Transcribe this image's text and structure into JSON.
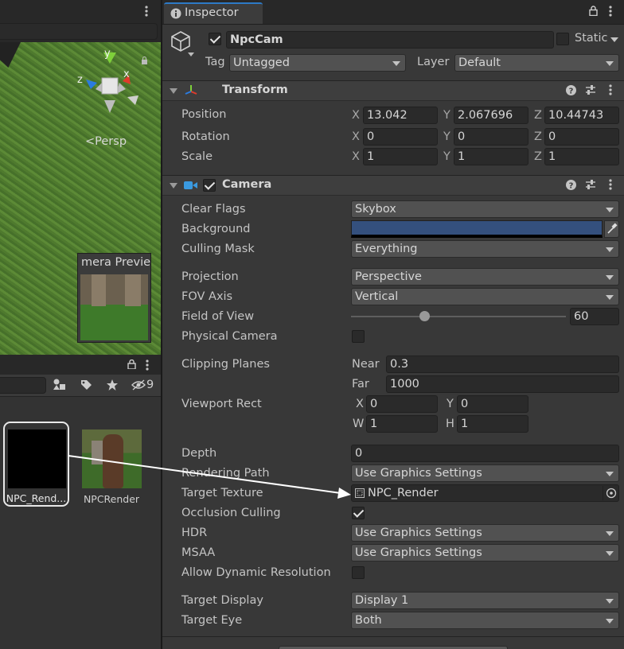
{
  "scene": {
    "gizmo": {
      "y": "y",
      "x": "x",
      "z": "z"
    },
    "persp_label": "<Persp",
    "preview_title": "mera Previe"
  },
  "project": {
    "visible_count": "9",
    "assets": [
      {
        "label": "NPC_Rend..."
      },
      {
        "label": "NPCRender"
      }
    ]
  },
  "inspector": {
    "tab_label": "Inspector",
    "object_name": "NpcCam",
    "static_label": "Static",
    "tag_label": "Tag",
    "tag_value": "Untagged",
    "layer_label": "Layer",
    "layer_value": "Default",
    "transform": {
      "title": "Transform",
      "position": {
        "label": "Position",
        "x": "13.042",
        "y": "2.067696",
        "z": "10.44743"
      },
      "rotation": {
        "label": "Rotation",
        "x": "0",
        "y": "0",
        "z": "0"
      },
      "scale": {
        "label": "Scale",
        "x": "1",
        "y": "1",
        "z": "1"
      },
      "axis": {
        "x": "X",
        "y": "Y",
        "z": "Z"
      }
    },
    "camera": {
      "title": "Camera",
      "clear_flags": {
        "label": "Clear Flags",
        "value": "Skybox"
      },
      "background": {
        "label": "Background",
        "color": "#34507e"
      },
      "culling_mask": {
        "label": "Culling Mask",
        "value": "Everything"
      },
      "projection": {
        "label": "Projection",
        "value": "Perspective"
      },
      "fov_axis": {
        "label": "FOV Axis",
        "value": "Vertical"
      },
      "field_of_view": {
        "label": "Field of View",
        "value": "60",
        "slider_fraction": 0.34
      },
      "physical_camera": {
        "label": "Physical Camera"
      },
      "clipping_planes": {
        "label": "Clipping Planes",
        "near_label": "Near",
        "near": "0.3",
        "far_label": "Far",
        "far": "1000"
      },
      "viewport_rect": {
        "label": "Viewport Rect",
        "x_label": "X",
        "x": "0",
        "y_label": "Y",
        "y": "0",
        "w_label": "W",
        "w": "1",
        "h_label": "H",
        "h": "1"
      },
      "depth": {
        "label": "Depth",
        "value": "0"
      },
      "rendering_path": {
        "label": "Rendering Path",
        "value": "Use Graphics Settings"
      },
      "target_texture": {
        "label": "Target Texture",
        "value": "NPC_Render"
      },
      "occlusion_culling": {
        "label": "Occlusion Culling"
      },
      "hdr": {
        "label": "HDR",
        "value": "Use Graphics Settings"
      },
      "msaa": {
        "label": "MSAA",
        "value": "Use Graphics Settings"
      },
      "allow_dynamic_resolution": {
        "label": "Allow Dynamic Resolution"
      },
      "target_display": {
        "label": "Target Display",
        "value": "Display 1"
      },
      "target_eye": {
        "label": "Target Eye",
        "value": "Both"
      }
    }
  },
  "colors": {
    "accent": "#2d7ac6",
    "arrow": "#ffffff"
  }
}
